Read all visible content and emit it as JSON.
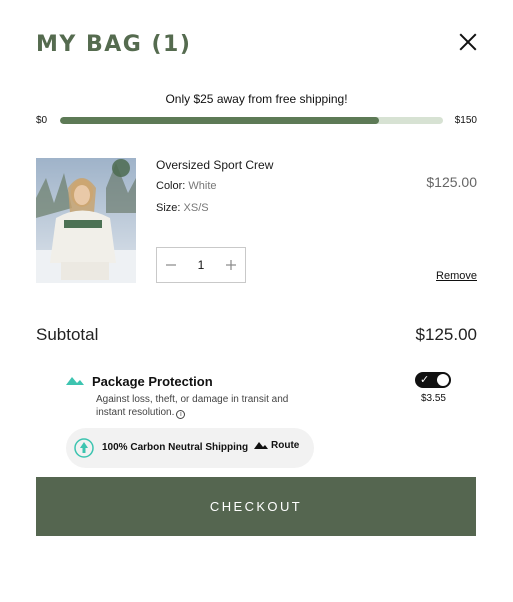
{
  "header": {
    "title": "MY BAG (1)"
  },
  "shipping": {
    "message": "Only $25 away from free shipping!",
    "min_label": "$0",
    "max_label": "$150",
    "progress_fraction": 0.8333
  },
  "item": {
    "name": "Oversized Sport Crew",
    "color_label": "Color:",
    "color_value": "White",
    "size_label": "Size:",
    "size_value": "XS/S",
    "price": "$125.00",
    "quantity": "1",
    "remove_label": "Remove"
  },
  "summary": {
    "subtotal_label": "Subtotal",
    "subtotal_value": "$125.00"
  },
  "protection": {
    "title": "Package Protection",
    "description": "Against loss, theft, or damage in transit and instant resolution.",
    "info_icon_char": "i",
    "price": "$3.55",
    "toggle_on": true
  },
  "carbon": {
    "text": "100% Carbon Neutral Shipping",
    "brand": "Route"
  },
  "checkout": {
    "label": "CHECKOUT"
  },
  "colors": {
    "accent": "#556b4f",
    "button": "#556650",
    "progress_track": "#d7e2d3",
    "progress_fill": "#5d7a56",
    "route_teal": "#3dc4b0"
  },
  "icons": {
    "close": "close-icon",
    "minus": "minus-icon",
    "plus": "plus-icon",
    "info": "info-icon",
    "route": "route-logo-icon",
    "carbon": "tree-icon"
  }
}
